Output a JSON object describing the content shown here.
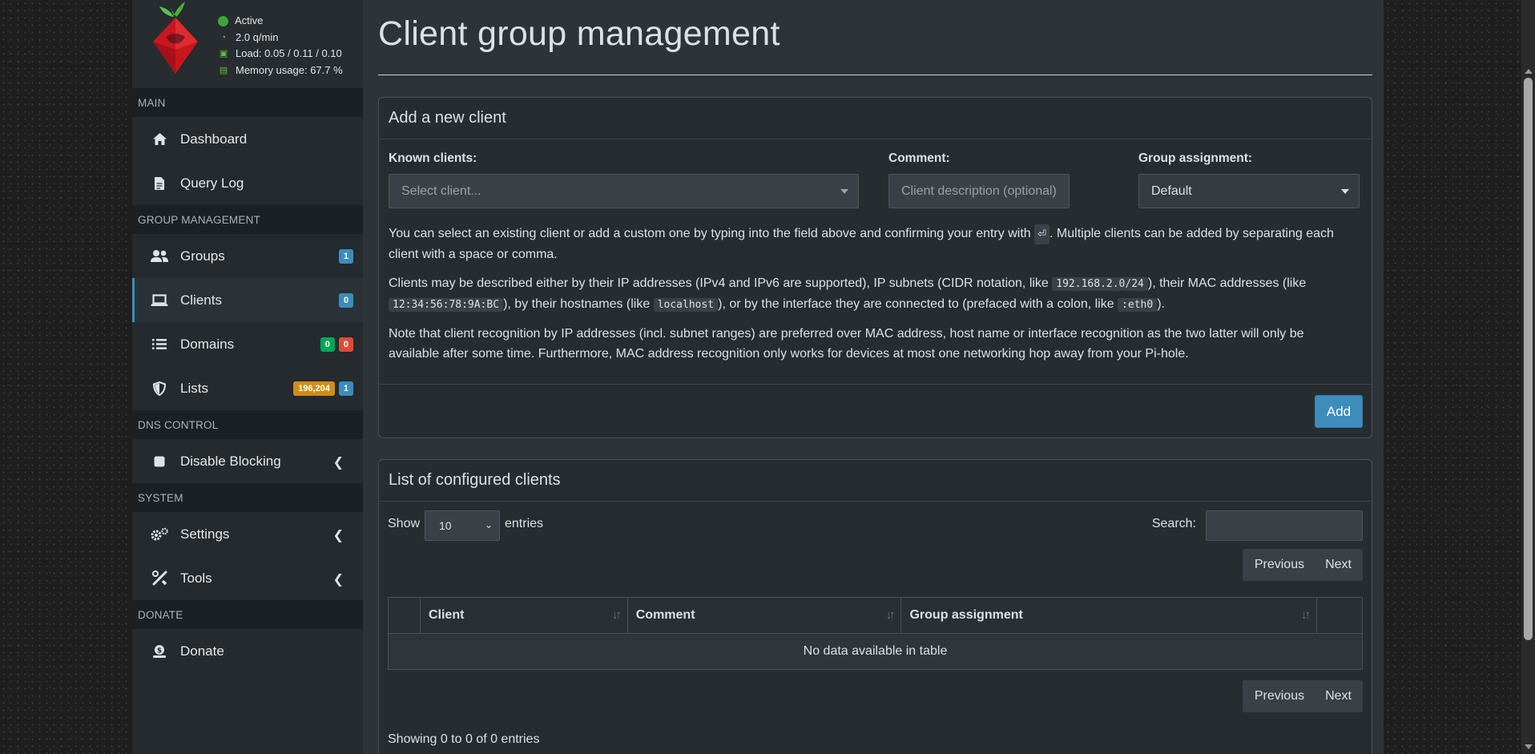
{
  "status": {
    "active": "Active",
    "qpm": "2.0 q/min",
    "load": "Load: 0.05 / 0.11 / 0.10",
    "memory": "Memory usage: 67.7 %"
  },
  "sidebar": {
    "main_header": "MAIN",
    "dashboard": "Dashboard",
    "query_log": "Query Log",
    "group_header": "GROUP MANAGEMENT",
    "groups": "Groups",
    "groups_badge": "1",
    "clients": "Clients",
    "clients_badge": "0",
    "domains": "Domains",
    "domains_badge_allow": "0",
    "domains_badge_deny": "0",
    "lists": "Lists",
    "lists_badge_count": "196,204",
    "lists_badge_lists": "1",
    "dns_header": "DNS CONTROL",
    "disable_blocking": "Disable Blocking",
    "system_header": "SYSTEM",
    "settings": "Settings",
    "tools": "Tools",
    "donate_header": "DONATE",
    "donate": "Donate"
  },
  "page": {
    "title": "Client group management"
  },
  "add_box": {
    "title": "Add a new client",
    "known_clients_label": "Known clients:",
    "known_clients_placeholder": "Select client...",
    "comment_label": "Comment:",
    "comment_placeholder": "Client description (optional)",
    "group_label": "Group assignment:",
    "group_value": "Default",
    "p1a": "You can select an existing client or add a custom one by typing into the field above and confirming your entry with ",
    "p1_key": "⏎",
    "p1b": ". Multiple clients can be added by separating each client with a space or comma.",
    "p2a": "Clients may be described either by their IP addresses (IPv4 and IPv6 are supported), IP subnets (CIDR notation, like ",
    "p2_code1": "192.168.2.0/24",
    "p2b": "), their MAC addresses (like ",
    "p2_code2": "12:34:56:78:9A:BC",
    "p2c": "), by their hostnames (like ",
    "p2_code3": "localhost",
    "p2d": "), or by the interface they are connected to (prefaced with a colon, like ",
    "p2_code4": ":eth0",
    "p2e": ").",
    "p3": "Note that client recognition by IP addresses (incl. subnet ranges) are preferred over MAC address, host name or interface recognition as the two latter will only be available after some time. Furthermore, MAC address recognition only works for devices at most one networking hop away from your Pi-hole.",
    "add_button": "Add"
  },
  "list_box": {
    "title": "List of configured clients",
    "show": "Show",
    "entries_value": "10",
    "entries": "entries",
    "search_label": "Search:",
    "previous": "Previous",
    "next": "Next",
    "col_client": "Client",
    "col_comment": "Comment",
    "col_group": "Group assignment",
    "empty": "No data available in table",
    "info": "Showing 0 to 0 of 0 entries"
  },
  "colors": {
    "accent": "#3c8dbc",
    "green": "#00a65a",
    "red": "#dd4b39",
    "yellow": "#d08e16"
  }
}
